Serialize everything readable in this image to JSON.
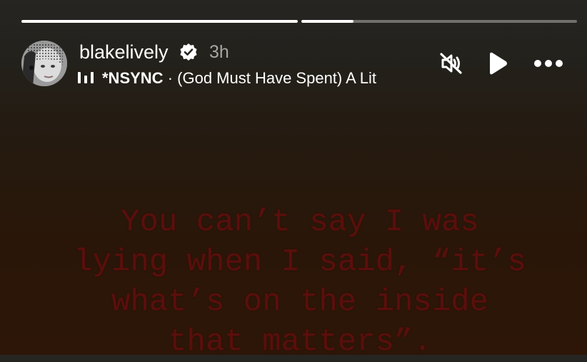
{
  "progress": {
    "segments": [
      {
        "fill": 1.0
      },
      {
        "fill": 0.19
      }
    ]
  },
  "header": {
    "username": "blakelively",
    "verified": true,
    "time": "3h",
    "music": {
      "artist": "*NSYNC",
      "separator": " · ",
      "title": "(God Must Have Spent) A Lit"
    }
  },
  "controls": {
    "mute_icon": "speaker-muted-icon",
    "play_icon": "play-icon",
    "more_icon": "more-horizontal-icon"
  },
  "story": {
    "text_lines": [
      "You can’t say I was",
      "lying when I said, “it’s",
      "what’s on the inside",
      "that matters”."
    ],
    "text_color": "#5a0f0c"
  },
  "colors": {
    "background_top": "#262522",
    "background_bottom": "#2d1607",
    "secondary_text": "#a9a6a2"
  }
}
